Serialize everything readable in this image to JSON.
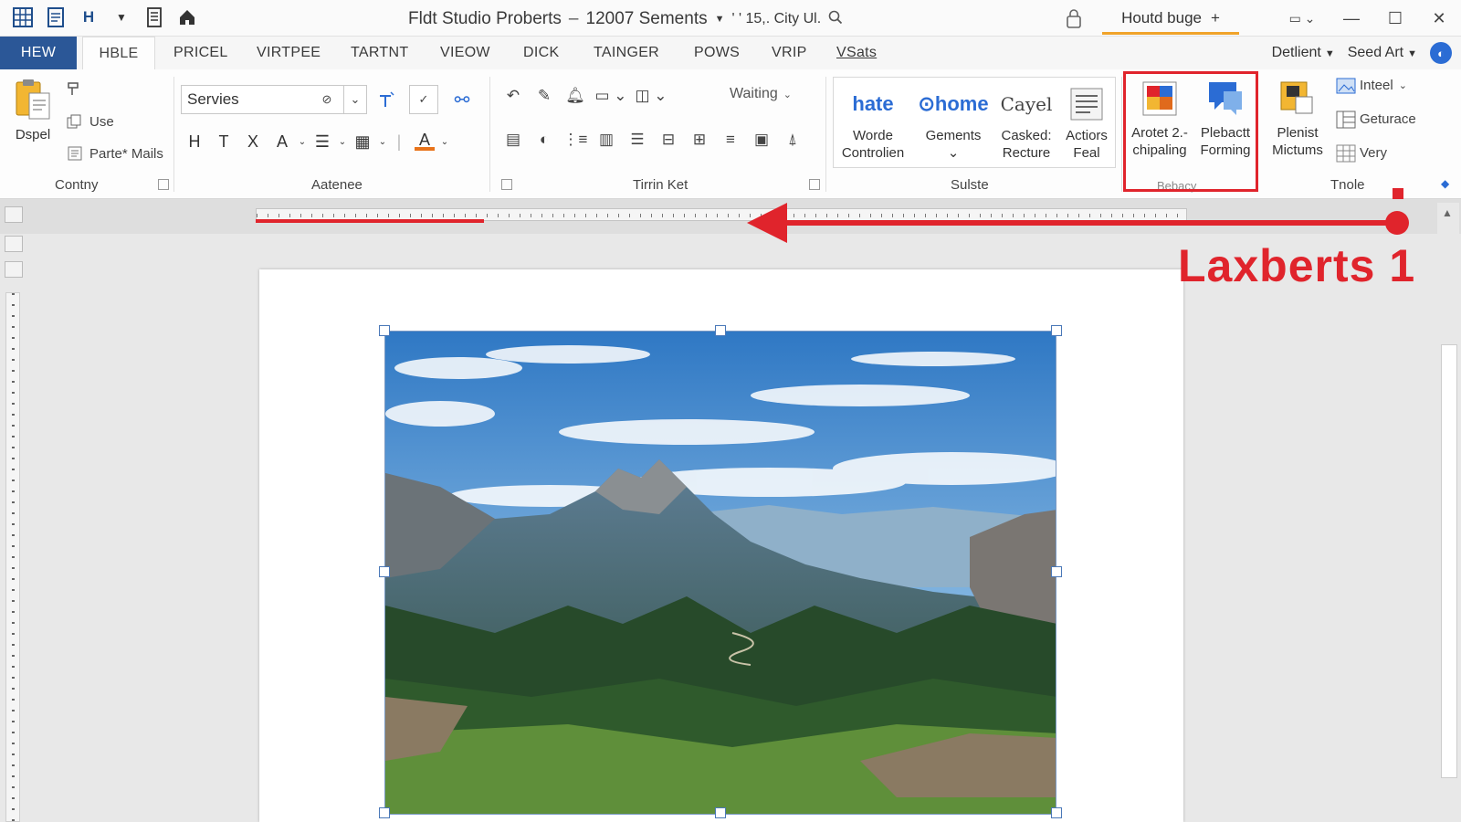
{
  "titlebar": {
    "qat_save_glyph": "H",
    "doc_title": "Fldt Studio Proberts",
    "dash": "–",
    "doc_subtitle": "12007 Sements",
    "location": "' ' 15,. City Ul.",
    "tab_label": "Houtd buge",
    "tab_add": "+"
  },
  "menu": {
    "file": "HEW",
    "tabs": [
      "HBLE",
      "PRICEL",
      "VIRTPEE",
      "TARTNT",
      "VIEOW",
      "DICK",
      "TAINGER",
      "POWS",
      "VRIP",
      "VSats"
    ],
    "right_account": "Detlient",
    "right_share": "Seed Art"
  },
  "ribbon": {
    "clipboard": {
      "paste_label": "Dspel",
      "use_label": "Use",
      "parte_label": "Parte* Mails",
      "group_label": "Contny"
    },
    "font": {
      "font_name": "Servies",
      "bold": "H",
      "italic": "T",
      "strike": "X",
      "size": "A",
      "font_color_glyph": "A",
      "group_label": "Aatenee"
    },
    "paragraph": {
      "waiting_label": "Waiting",
      "group_label": "Tirrin Ket"
    },
    "styles": {
      "items": [
        {
          "preview": "hate",
          "label_1": "Worde",
          "label_2": "Controlien"
        },
        {
          "preview": "home",
          "label_1": "Gements",
          "label_2": "⌄"
        },
        {
          "preview": "Cayel",
          "label_1": "Casked:",
          "label_2": "Recture"
        },
        {
          "preview": "",
          "label_1": "Actiors",
          "label_2": "Feal"
        }
      ],
      "group_label": "Sulste"
    },
    "highlighted": {
      "btn1_line1": "Arotet 2.-",
      "btn1_line2": "chipaling",
      "btn2_line1": "Plebactt",
      "btn2_line2": "Forming",
      "group_label": "Bebacy"
    },
    "tools": {
      "plenist_1": "Plenist",
      "plenist_2": "Mictums",
      "inteel": "Inteel",
      "geturace": "Geturace",
      "very": "Very",
      "group_label": "Tnole"
    }
  },
  "annotation": {
    "label": "Laxberts 1",
    "color": "#e0242c"
  },
  "colors": {
    "accent_blue": "#2b5797",
    "tab_underline": "#f0a32a",
    "annotation_red": "#e0242c"
  }
}
